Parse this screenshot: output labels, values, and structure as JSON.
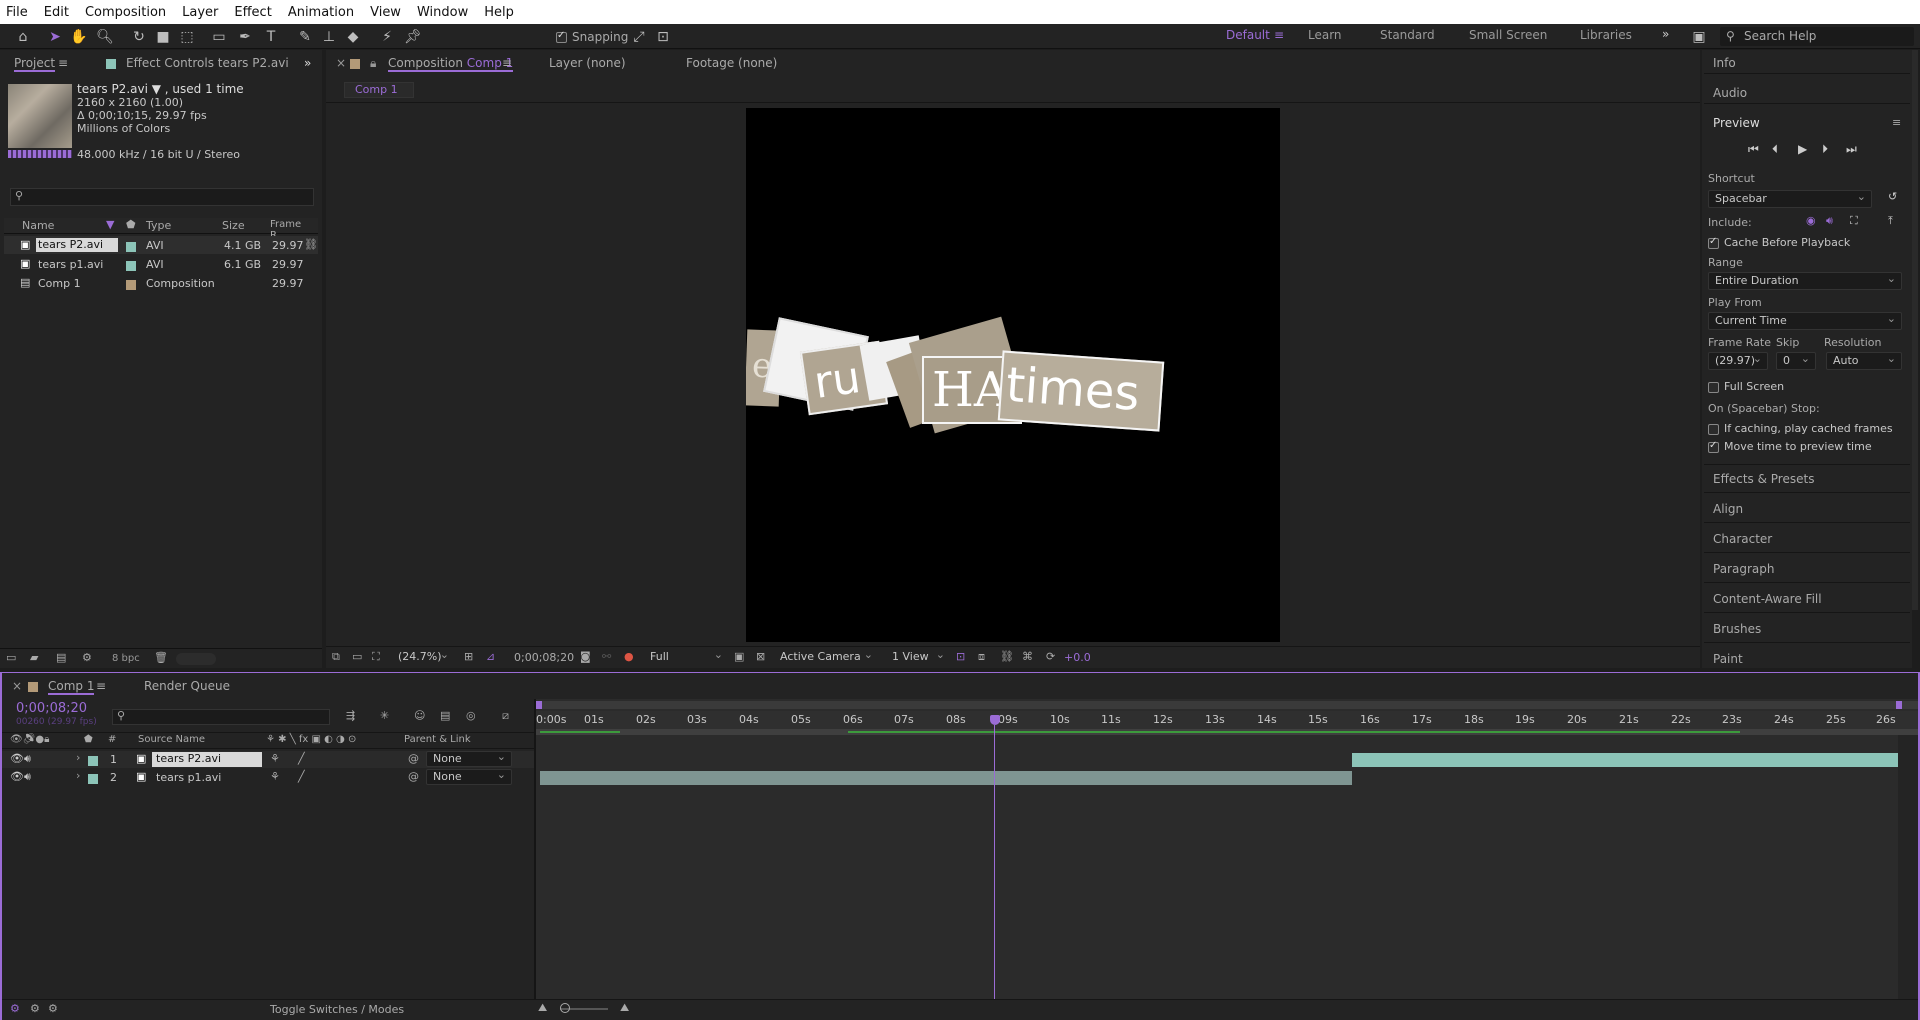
{
  "menu": [
    "File",
    "Edit",
    "Composition",
    "Layer",
    "Effect",
    "Animation",
    "View",
    "Window",
    "Help"
  ],
  "toolbar": {
    "snapping_label": "Snapping",
    "search_placeholder": "Search Help"
  },
  "workspaces": [
    "Default",
    "Learn",
    "Standard",
    "Small Screen",
    "Libraries"
  ],
  "project": {
    "tab_project": "Project",
    "tab_effects": "Effect Controls tears P2.avi",
    "item_name": "tears P2.avi ▼ , used 1 time",
    "item_res": "2160 x 2160 (1.00)",
    "item_dur": "Δ 0;00;10;15, 29.97 fps",
    "item_colors": "Millions of Colors",
    "item_audio": "48.000 kHz / 16 bit U / Stereo",
    "columns": {
      "name": "Name",
      "type": "Type",
      "size": "Size",
      "frame": "Frame R..."
    },
    "rows": [
      {
        "name": "tears P2.avi",
        "type": "AVI",
        "size": "4.1 GB",
        "fr": "29.97"
      },
      {
        "name": "tears p1.avi",
        "type": "AVI",
        "size": "6.1 GB",
        "fr": "29.97"
      },
      {
        "name": "Comp 1",
        "type": "Composition",
        "size": "",
        "fr": "29.97"
      }
    ],
    "bpc": "8 bpc"
  },
  "comp": {
    "tab_prefix": "Composition",
    "tab_name": "Comp 1",
    "tab_layer": "Layer (none)",
    "tab_footage": "Footage (none)",
    "crumb": "Comp 1",
    "zoom": "(24.7%)",
    "time": "0;00;08;20",
    "quality": "Full",
    "camera": "Active Camera",
    "views": "1 View",
    "exposure": "+0.0",
    "canvas_words": [
      "e",
      "ru",
      "HA",
      "times"
    ]
  },
  "right": {
    "info": "Info",
    "audio": "Audio",
    "preview": "Preview",
    "shortcut_label": "Shortcut",
    "shortcut": "Spacebar",
    "include": "Include:",
    "cache": "Cache Before Playback",
    "range_label": "Range",
    "range": "Entire Duration",
    "playfrom_label": "Play From",
    "playfrom": "Current Time",
    "fr_label": "Frame Rate",
    "skip_label": "Skip",
    "res_label": "Resolution",
    "fr": "(29.97)",
    "skip": "0",
    "res": "Auto",
    "fullscreen": "Full Screen",
    "stop_label": "On (Spacebar) Stop:",
    "ifcaching": "If caching, play cached frames",
    "movetime": "Move time to preview time",
    "panels": [
      "Effects & Presets",
      "Align",
      "Character",
      "Paragraph",
      "Content-Aware Fill",
      "Brushes",
      "Paint"
    ]
  },
  "timeline": {
    "tab": "Comp 1",
    "render_queue": "Render Queue",
    "timecode": "0;00;08;20",
    "frames": "00260 (29.97 fps)",
    "col_source": "Source Name",
    "col_parent": "Parent & Link",
    "layers": [
      {
        "num": "1",
        "name": "tears P2.avi",
        "parent": "None"
      },
      {
        "num": "2",
        "name": "tears p1.avi",
        "parent": "None"
      }
    ],
    "ruler": [
      "0:00s",
      "01s",
      "02s",
      "03s",
      "04s",
      "05s",
      "06s",
      "07s",
      "08s",
      "09s",
      "10s",
      "11s",
      "12s",
      "13s",
      "14s",
      "15s",
      "16s",
      "17s",
      "18s",
      "19s",
      "20s",
      "21s",
      "22s",
      "23s",
      "24s",
      "25s",
      "26s"
    ],
    "toggle": "Toggle Switches / Modes"
  },
  "colors": {
    "accent": "#9b6cd6",
    "layer_teal": "#8cc4b8",
    "comp_swatch": "#b39a78",
    "panel": "#232323"
  }
}
